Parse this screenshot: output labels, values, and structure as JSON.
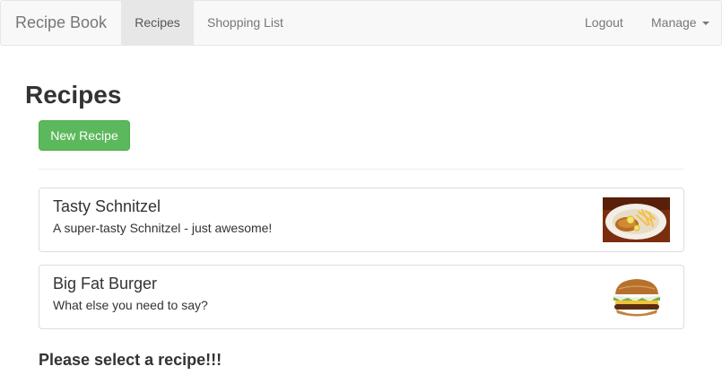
{
  "navbar": {
    "brand": "Recipe Book",
    "items": [
      {
        "label": "Recipes",
        "active": true
      },
      {
        "label": "Shopping List",
        "active": false
      }
    ],
    "right_items": [
      {
        "label": "Logout"
      },
      {
        "label": "Manage"
      }
    ]
  },
  "main": {
    "title": "Recipes",
    "new_button_label": "New Recipe",
    "recipes": [
      {
        "name": "Tasty Schnitzel",
        "description": "A super-tasty Schnitzel - just awesome!",
        "image_icon": "schnitzel-image"
      },
      {
        "name": "Big Fat Burger",
        "description": "What else you need to say?",
        "image_icon": "burger-image"
      }
    ],
    "select_message": "Please select a recipe!!!"
  },
  "colors": {
    "accent_green": "#5cb85c",
    "navbar_bg": "#f8f8f8",
    "nav_active_bg": "#e7e7e7"
  }
}
